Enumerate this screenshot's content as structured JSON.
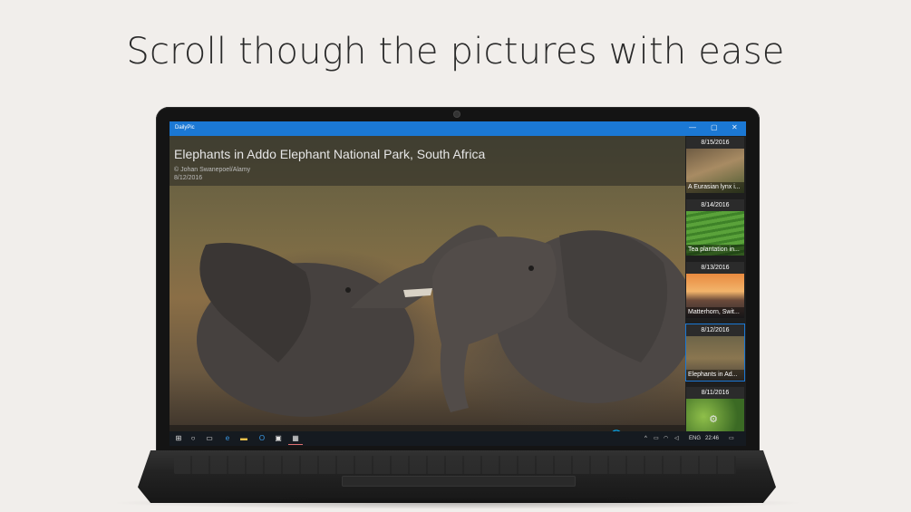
{
  "headline": "Scroll though the pictures with ease",
  "window": {
    "app_title": "DailyPic",
    "minimize": "—",
    "maximize": "▢",
    "close": "✕"
  },
  "photo": {
    "title": "Elephants in Addo Elephant National Park, South Africa",
    "credit": "© Johan Swanepoel/Alamy",
    "date": "8/12/2016"
  },
  "appbar": [
    {
      "icon": "globe-icon",
      "glyph": "🌐"
    },
    {
      "icon": "download-icon",
      "glyph": "⤓"
    },
    {
      "icon": "calendar-icon",
      "glyph": "▦"
    },
    {
      "icon": "gear-icon",
      "glyph": "⚙"
    }
  ],
  "history": [
    {
      "date": "8/15/2016",
      "caption": "A Eurasian lynx i...",
      "selected": false
    },
    {
      "date": "8/14/2016",
      "caption": "Tea plantation in...",
      "selected": false
    },
    {
      "date": "8/13/2016",
      "caption": "Matterhorn, Swit...",
      "selected": false
    },
    {
      "date": "8/12/2016",
      "caption": "Elephants in Ad...",
      "selected": true
    },
    {
      "date": "8/11/2016",
      "caption": "",
      "selected": false
    }
  ],
  "taskbar": {
    "start_glyph": "⊞",
    "cortana_glyph": "○",
    "taskview_glyph": "▭",
    "edge_glyph": "e",
    "explorer_glyph": "▬",
    "outlook_glyph": "O",
    "store_glyph": "▣",
    "dailypic_glyph": "▦",
    "tray_chevron": "^",
    "tray_lang": "ENG",
    "tray_time": "22:46",
    "notification_glyph": "▭"
  }
}
